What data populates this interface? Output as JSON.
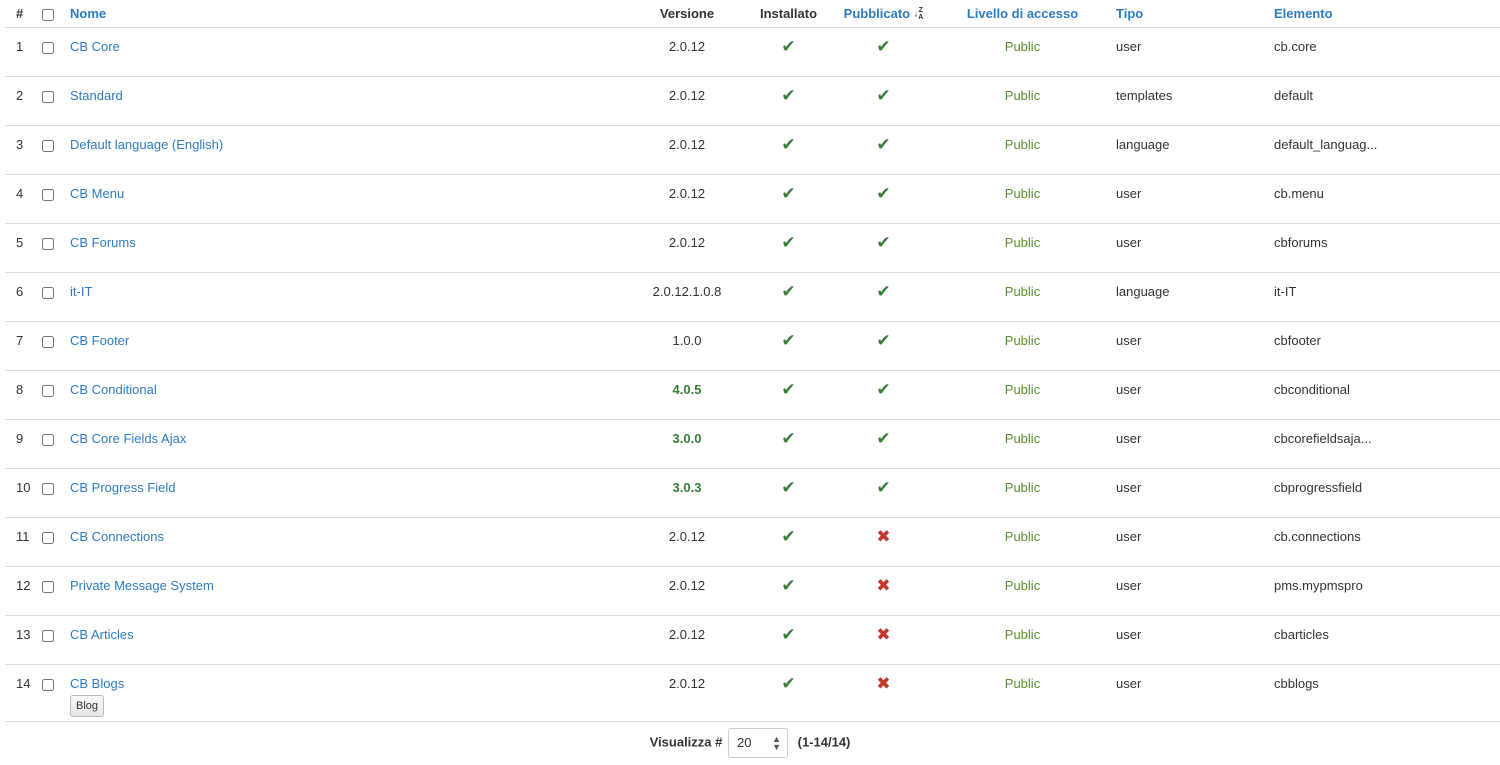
{
  "header": {
    "num": "#",
    "nome": "Nome",
    "versione": "Versione",
    "installato": "Installato",
    "pubblicato": "Pubblicato",
    "sort_icon": "sort-alpha-desc-icon",
    "livello": "Livello di accesso",
    "tipo": "Tipo",
    "elemento": "Elemento"
  },
  "rows": [
    {
      "num": "1",
      "name": "CB Core",
      "version": "2.0.12",
      "installed": true,
      "published": true,
      "access": "Public",
      "type": "user",
      "element": "cb.core"
    },
    {
      "num": "2",
      "name": "Standard",
      "version": "2.0.12",
      "installed": true,
      "published": true,
      "access": "Public",
      "type": "templates",
      "element": "default"
    },
    {
      "num": "3",
      "name": "Default language (English)",
      "version": "2.0.12",
      "installed": true,
      "published": true,
      "access": "Public",
      "type": "language",
      "element": "default_languag..."
    },
    {
      "num": "4",
      "name": "CB Menu",
      "version": "2.0.12",
      "installed": true,
      "published": true,
      "access": "Public",
      "type": "user",
      "element": "cb.menu"
    },
    {
      "num": "5",
      "name": "CB Forums",
      "version": "2.0.12",
      "installed": true,
      "published": true,
      "access": "Public",
      "type": "user",
      "element": "cbforums"
    },
    {
      "num": "6",
      "name": "it-IT",
      "version": "2.0.12.1.0.8",
      "installed": true,
      "published": true,
      "access": "Public",
      "type": "language",
      "element": "it-IT"
    },
    {
      "num": "7",
      "name": "CB Footer",
      "version": "1.0.0",
      "installed": true,
      "published": true,
      "access": "Public",
      "type": "user",
      "element": "cbfooter"
    },
    {
      "num": "8",
      "name": "CB Conditional",
      "version": "4.0.5",
      "version_update": true,
      "installed": true,
      "published": true,
      "access": "Public",
      "type": "user",
      "element": "cbconditional"
    },
    {
      "num": "9",
      "name": "CB Core Fields Ajax",
      "version": "3.0.0",
      "version_update": true,
      "installed": true,
      "published": true,
      "access": "Public",
      "type": "user",
      "element": "cbcorefieldsaja..."
    },
    {
      "num": "10",
      "name": "CB Progress Field",
      "version": "3.0.3",
      "version_update": true,
      "installed": true,
      "published": true,
      "access": "Public",
      "type": "user",
      "element": "cbprogressfield"
    },
    {
      "num": "11",
      "name": "CB Connections",
      "version": "2.0.12",
      "installed": true,
      "published": false,
      "access": "Public",
      "type": "user",
      "element": "cb.connections"
    },
    {
      "num": "12",
      "name": "Private Message System",
      "version": "2.0.12",
      "installed": true,
      "published": false,
      "access": "Public",
      "type": "user",
      "element": "pms.mypmspro"
    },
    {
      "num": "13",
      "name": "CB Articles",
      "version": "2.0.12",
      "installed": true,
      "published": false,
      "access": "Public",
      "type": "user",
      "element": "cbarticles"
    },
    {
      "num": "14",
      "name": "CB Blogs",
      "badge": "Blog",
      "version": "2.0.12",
      "installed": true,
      "published": false,
      "access": "Public",
      "type": "user",
      "element": "cbblogs"
    }
  ],
  "footer": {
    "label": "Visualizza #",
    "limit_value": "20",
    "range": "(1-14/14)"
  },
  "colors": {
    "link": "#2f7bbf",
    "check": "#3a7d3a",
    "cross": "#c0392b",
    "access": "#5a8f2e"
  }
}
